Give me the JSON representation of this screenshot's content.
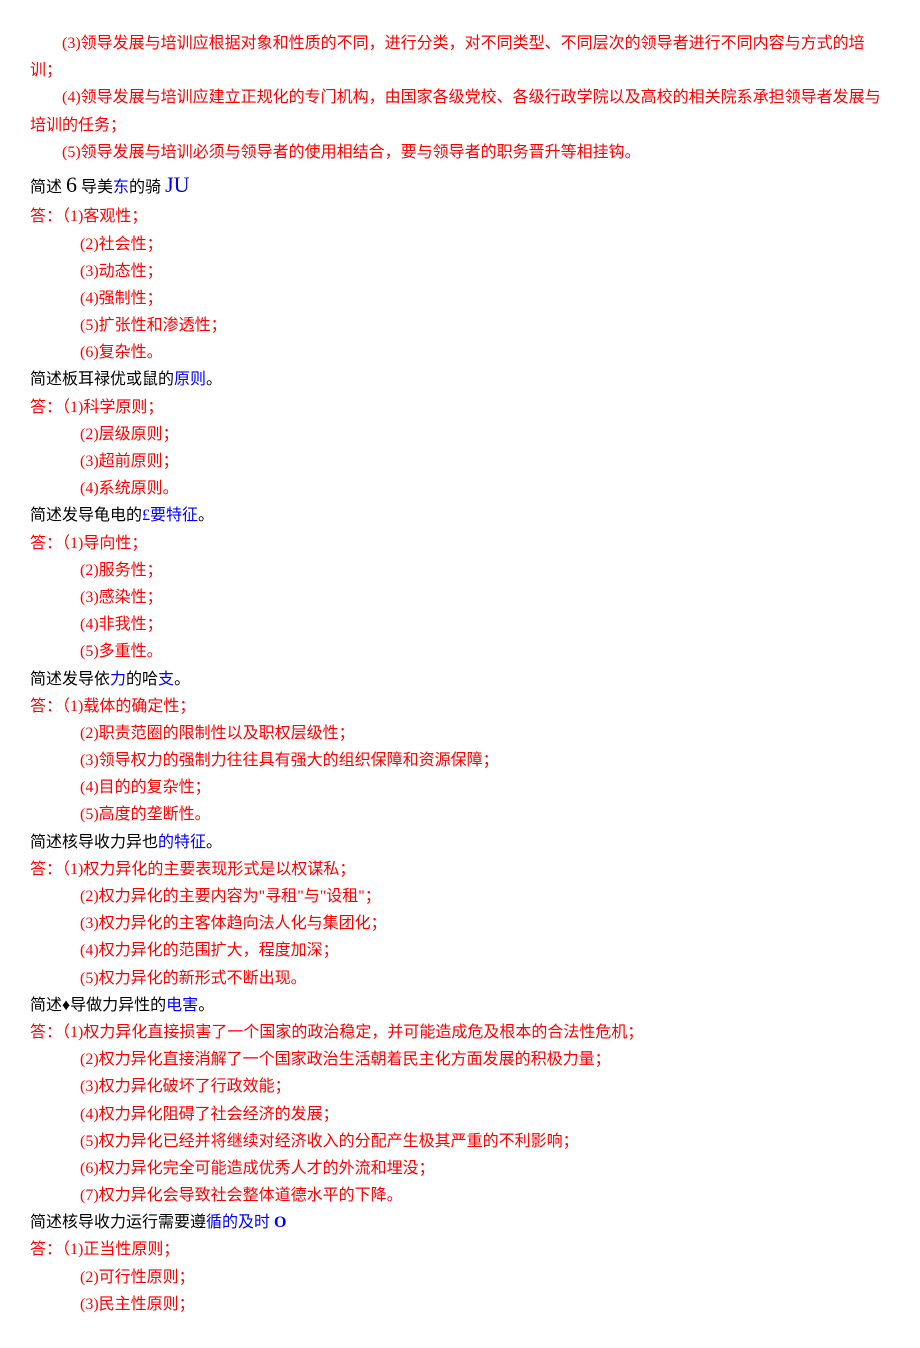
{
  "intro": {
    "line1": "(3)领导发展与培训应根据对象和性质的不同，进行分类，对不同类型、不同层次的领导者进行不同内容与方式的培训；",
    "line2": "(4)领导发展与培训应建立正规化的专门机构，由国家各级党校、各级行政学院以及高校的相关院系承担领导者发展与培训的任务；",
    "line3": "(5)领导发展与培训必须与领导者的使用相结合，要与领导者的职务晋升等相挂钩。"
  },
  "s1": {
    "q1": "简述 ",
    "q2": "6",
    "q3": " 导美",
    "q4": "东",
    "q5": "的骑 ",
    "q6": "JU",
    "a_prefix": "答：",
    "a1": "（1)客观性；",
    "a2": "(2)社会性；",
    "a3": "(3)动态性；",
    "a4": "(4)强制性；",
    "a5": "(5)扩张性和渗透性；",
    "a6": "(6)复杂性。"
  },
  "s2": {
    "q1": "简述板耳禄优或鼠的",
    "q2": "原则",
    "q3": "。",
    "a_prefix": "答：",
    "a1": "（1)科学原则；",
    "a2": "(2)层级原则；",
    "a3": "(3)超前原则；",
    "a4": "(4)系统原则。"
  },
  "s3": {
    "q1": "简述发导龟电的",
    "q2": "£",
    "q3": "要特征",
    "q4": "。",
    "a_prefix": "答：",
    "a1": "（1)导向性；",
    "a2": "(2)服务性；",
    "a3": "(3)感染性；",
    "a4": "(4)非我性；",
    "a5": "(5)多重性。"
  },
  "s4": {
    "q1": "简述发导依",
    "q2": "力",
    "q3": "的哈",
    "q4": "支",
    "q5": "。",
    "a_prefix": "答：",
    "a1": "（1)载体的确定性；",
    "a2": "(2)职责范圈的限制性以及职权层级性；",
    "a3": "(3)领导权力的强制力往往具有强大的组织保障和资源保障；",
    "a4": "(4)目的的复杂性；",
    "a5": "(5)高度的垄断性。"
  },
  "s5": {
    "q1": "简述核导收力异也",
    "q2": "的特征",
    "q3": "。",
    "a_prefix": "答：",
    "a1": "（1)权力异化的主要表现形式是以权谋私；",
    "a2": "(2)权力异化的主要内容为\"寻租\"与\"设租\"；",
    "a3": "(3)权力异化的主客体趋向法人化与集团化；",
    "a4": "(4)权力异化的范围扩大，程度加深；",
    "a5": "(5)权力异化的新形式不断出现。"
  },
  "s6": {
    "q1": "简述♦导做力异性的",
    "q2": "电害",
    "q3": "。",
    "a_prefix": "答：",
    "a1": "（1)权力异化直接损害了一个国家的政治稳定，并可能造成危及根本的合法性危机；",
    "a2": "(2)权力异化直接消解了一个国家政治生活朝着民主化方面发展的积极力量；",
    "a3": "(3)权力异化破坏了行政效能；",
    "a4": "(4)权力异化阻碍了社会经济的发展；",
    "a5": "(5)权力异化已经并将继续对经济收入的分配产生极其严重的不利影响；",
    "a6": "(6)权力异化完全可能造成优秀人才的外流和埋没；",
    "a7": "(7)权力异化会导致社会整体道德水平的下降。"
  },
  "s7": {
    "q1": "简述核导收力运行需要遵",
    "q2": "循的及时",
    "q3": " ",
    "q4": "O",
    "a_prefix": "答：",
    "a1": "（1)正当性原则；",
    "a2": "(2)可行性原则；",
    "a3": "(3)民主性原则；"
  }
}
